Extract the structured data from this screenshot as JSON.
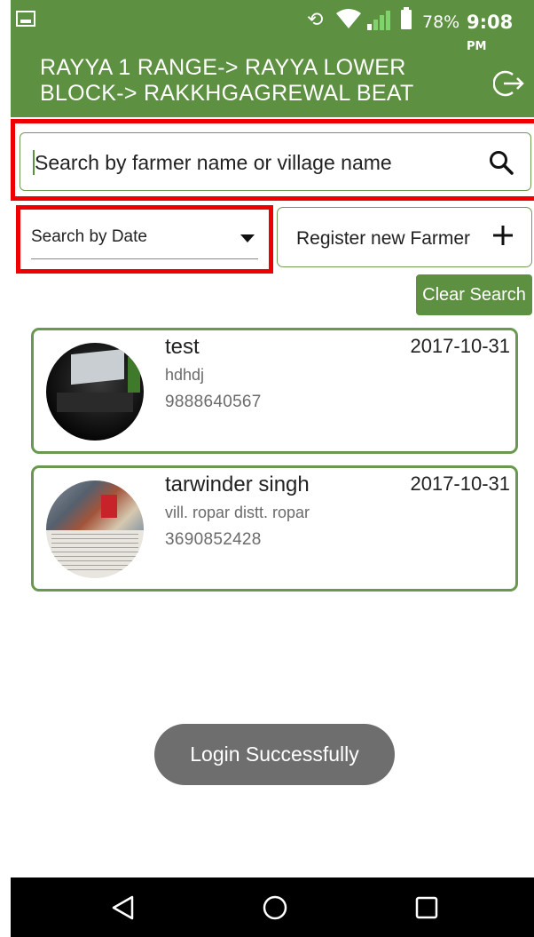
{
  "status_bar": {
    "battery": "78%",
    "time": "9:08",
    "ampm": "PM"
  },
  "header": {
    "title": "RAYYA 1 RANGE-> RAYYA LOWER BLOCK-> RAKKHGAGREWAL BEAT"
  },
  "search": {
    "placeholder": "Search by farmer name or village name"
  },
  "date_filter": {
    "label": "Search by Date"
  },
  "register_button": {
    "label": "Register new Farmer"
  },
  "clear_button": {
    "label": "Clear Search"
  },
  "farmers": [
    {
      "name": "test",
      "village": "hdhdj",
      "phone": "9888640567",
      "date": "2017-10-31"
    },
    {
      "name": "tarwinder singh",
      "village": "vill. ropar distt. ropar",
      "phone": "3690852428",
      "date": "2017-10-31"
    }
  ],
  "toast": {
    "message": "Login Successfully"
  },
  "colors": {
    "primary": "#5d9141",
    "highlight": "#ee0000",
    "card_border": "#6a9850"
  },
  "icons": [
    "gallery-icon",
    "rotate-icon",
    "wifi-icon",
    "signal-icon",
    "battery-icon",
    "logout-icon",
    "search-icon",
    "dropdown-arrow-icon",
    "plus-icon",
    "back-icon",
    "home-icon",
    "recents-icon"
  ]
}
